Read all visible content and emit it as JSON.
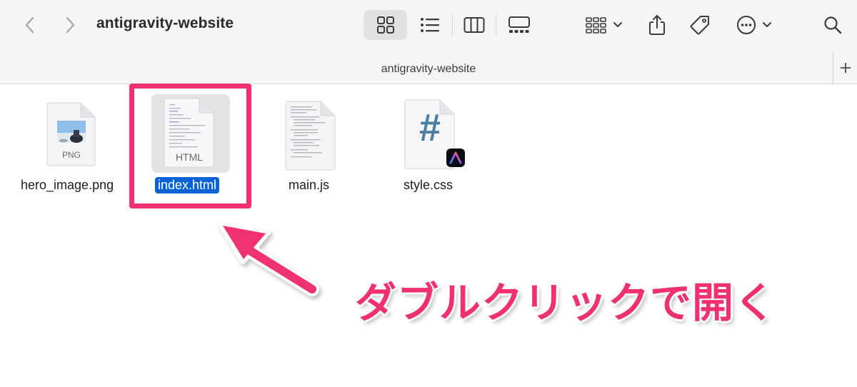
{
  "window": {
    "title": "antigravity-website",
    "path_title": "antigravity-website"
  },
  "toolbar": {
    "back_icon": "chevron-left-icon",
    "forward_icon": "chevron-right-icon",
    "views": [
      "icon-view",
      "list-view",
      "column-view",
      "gallery-view"
    ],
    "selected_view": "icon-view",
    "group_icon": "group-grid-icon",
    "share_icon": "share-icon",
    "tag_icon": "tag-icon",
    "more_icon": "ellipsis-circle-icon",
    "search_icon": "search-icon"
  },
  "files": [
    {
      "name": "hero_image.png",
      "badge": "PNG",
      "type": "png",
      "selected": false
    },
    {
      "name": "index.html",
      "badge": "HTML",
      "type": "html",
      "selected": true
    },
    {
      "name": "main.js",
      "badge": "",
      "type": "js",
      "selected": false
    },
    {
      "name": "style.css",
      "badge": "#",
      "type": "css",
      "selected": false
    }
  ],
  "annotation": {
    "text": "ダブルクリックで開く",
    "color": "#f0306f"
  },
  "colors": {
    "selection": "#0a63d6",
    "accent": "#f0306f",
    "toolbar_bg": "#f5f5f7"
  }
}
